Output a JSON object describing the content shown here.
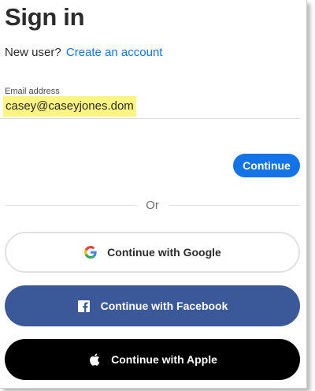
{
  "header": {
    "title": "Sign in",
    "new_user_prompt": "New user?",
    "create_account_link": "Create an account"
  },
  "email": {
    "label": "Email address",
    "value": "casey@caseyjones.dom",
    "highlight_color": "#fbf582"
  },
  "actions": {
    "continue_label": "Continue",
    "divider_text": "Or"
  },
  "social": {
    "google_label": "Continue with Google",
    "google_icon": "google-icon",
    "facebook_label": "Continue with Facebook",
    "facebook_icon": "facebook-icon",
    "apple_label": "Continue with Apple",
    "apple_icon": "apple-icon"
  },
  "colors": {
    "accent": "#1473e6",
    "facebook": "#3b5998",
    "apple": "#000000"
  }
}
